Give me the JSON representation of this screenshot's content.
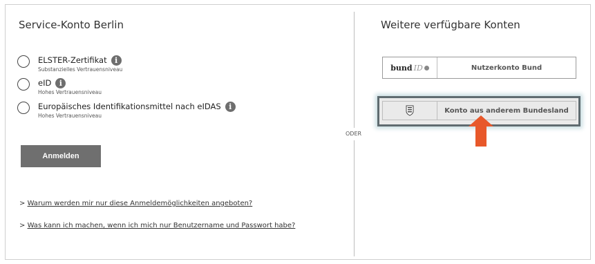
{
  "left": {
    "title": "Service-Konto Berlin",
    "options": [
      {
        "label": "ELSTER-Zertifikat",
        "sub": "Substanzielles Vertrauensniveau"
      },
      {
        "label": "eID",
        "sub": "Hohes Vertrauensniveau"
      },
      {
        "label": "Europäisches Identifikationsmittel nach eIDAS",
        "sub": "Hohes Vertrauensniveau"
      }
    ],
    "login_label": "Anmelden",
    "links": [
      {
        "prefix": "> ",
        "text": "Warum werden mir nur diese Anmeldemöglichkeiten angeboten?"
      },
      {
        "prefix": "> ",
        "text": "Was kann ich machen, wenn ich mich nur Benutzername und Passwort habe?"
      }
    ]
  },
  "divider_label": "ODER",
  "right": {
    "title": "Weitere verfügbare Konten",
    "accounts": [
      {
        "logo_main": "bund",
        "logo_id": "ID",
        "label": "Nutzerkonto Bund",
        "icon": "bund-id-logo"
      },
      {
        "label": "Konto aus anderem Bundesland",
        "icon": "state-coat-of-arms-icon"
      }
    ]
  },
  "colors": {
    "button_bg": "#6f6f6f",
    "highlight_border": "#5f6b70",
    "arrow": "#e8582a"
  }
}
